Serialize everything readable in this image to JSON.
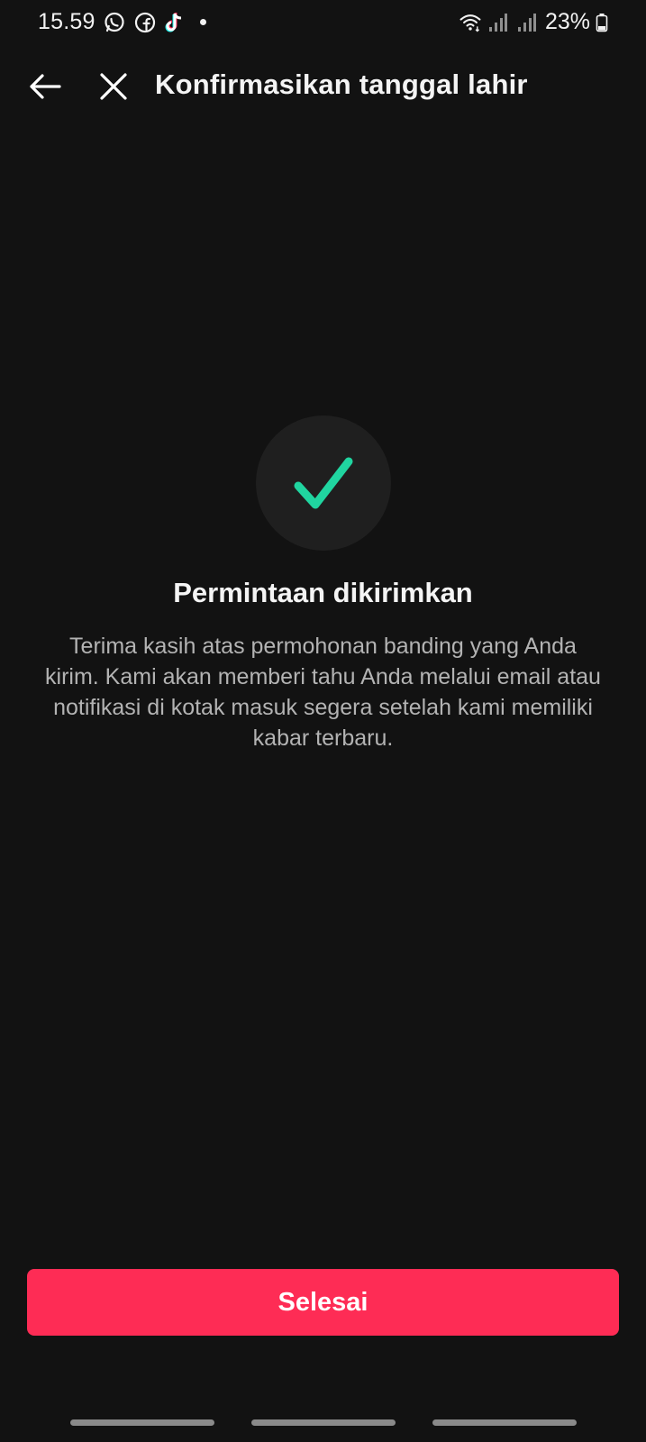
{
  "status_bar": {
    "time": "15.59",
    "battery_percent": "23%",
    "notification_icons": [
      "whatsapp-icon",
      "facebook-icon",
      "tiktok-icon",
      "more-notifications-dot"
    ],
    "system_icons": [
      "wifi-icon",
      "signal-icon",
      "signal-icon",
      "battery-icon"
    ]
  },
  "header": {
    "title": "Konfirmasikan tanggal lahir",
    "back_icon": "arrow-left-icon",
    "close_icon": "close-icon"
  },
  "main": {
    "status_icon": "checkmark-icon",
    "title": "Permintaan dikirimkan",
    "message": "Terima kasih atas permohonan banding yang Anda kirim. Kami akan memberi tahu Anda melalui email atau notifikasi di kotak masuk segera setelah kami memiliki kabar terbaru."
  },
  "footer": {
    "done_label": "Selesai"
  },
  "colors": {
    "background": "#121212",
    "accent": "#fe2c55",
    "success": "#20d5a0",
    "circle": "#1f1f1f"
  }
}
